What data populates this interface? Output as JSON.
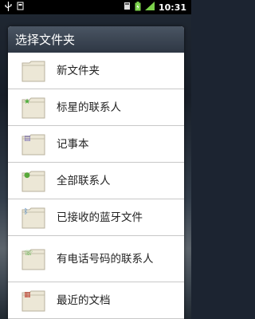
{
  "status_bar": {
    "time": "10:31",
    "icons": [
      "usb-icon",
      "storage-icon",
      "battery-charging-icon",
      "signal-icon",
      "notification-icon"
    ]
  },
  "dialog": {
    "title": "选择文件夹",
    "items": [
      {
        "label": "新文件夹",
        "icon": "folder-icon",
        "badge": "",
        "badge_color": ""
      },
      {
        "label": "标星的联系人",
        "icon": "starred-contacts-folder-icon",
        "badge": "★",
        "badge_color": "#4caf3b"
      },
      {
        "label": "记事本",
        "icon": "notes-folder-icon",
        "badge": "▤",
        "badge_color": "#7a6fb8"
      },
      {
        "label": "全部联系人",
        "icon": "contacts-folder-icon",
        "badge": "●",
        "badge_color": "#58a83a"
      },
      {
        "label": "已接收的蓝牙文件",
        "icon": "bluetooth-folder-icon",
        "badge": "ᛒ",
        "badge_color": "#2f78c8"
      },
      {
        "label": "有电话号码的联系人",
        "icon": "phone-contacts-folder-icon",
        "badge": "☏",
        "badge_color": "#4caf3b"
      },
      {
        "label": "最近的文档",
        "icon": "recent-documents-folder-icon",
        "badge": "▦",
        "badge_color": "#c04a3a"
      }
    ]
  },
  "colors": {
    "folder_fill": "#ece7d6",
    "folder_edge": "#b9b29d",
    "header_bg": "#37404d"
  }
}
